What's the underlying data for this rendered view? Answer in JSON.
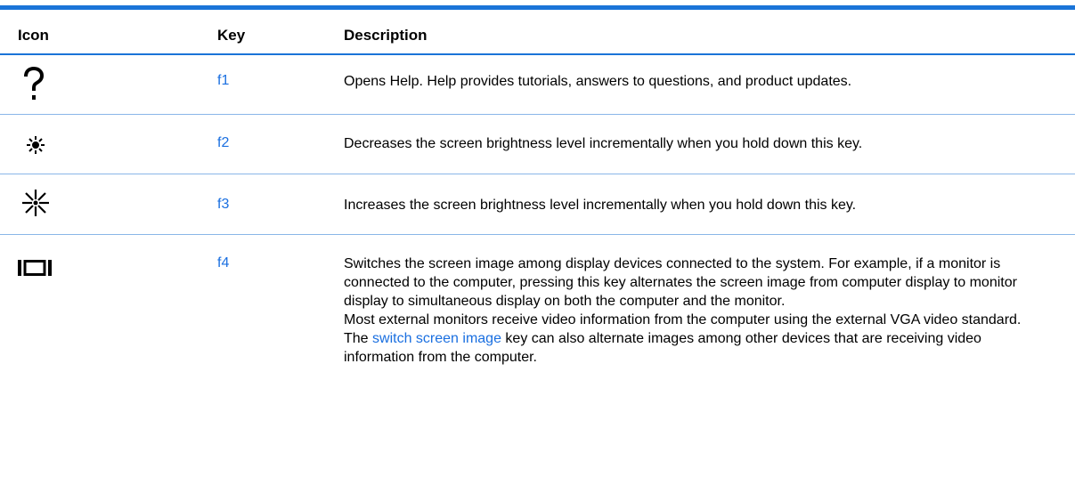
{
  "table": {
    "headers": {
      "icon": "Icon",
      "key": "Key",
      "description": "Description"
    },
    "rows": [
      {
        "icon": "question-mark-icon",
        "key": "f1",
        "description": "Opens Help. Help provides tutorials, answers to questions, and product updates."
      },
      {
        "icon": "brightness-down-icon",
        "key": "f2",
        "description": "Decreases the screen brightness level incrementally when you hold down this key."
      },
      {
        "icon": "brightness-up-icon",
        "key": "f3",
        "description": "Increases the screen brightness level incrementally when you hold down this key."
      },
      {
        "icon": "switch-screen-icon",
        "key": "f4",
        "description": "Switches the screen image among display devices connected to the system. For example, if a monitor is connected to the computer, pressing this key alternates the screen image from computer display to monitor display to simultaneous display on both the computer and the monitor.",
        "note_before_link": "Most external monitors receive video information from the computer using the external VGA video standard. The ",
        "note_link": "switch screen image",
        "note_after_link": " key can also alternate images among other devices that are receiving video information from the computer."
      }
    ]
  },
  "colors": {
    "rule": "#1a74d8",
    "link": "#1a6fe0"
  }
}
